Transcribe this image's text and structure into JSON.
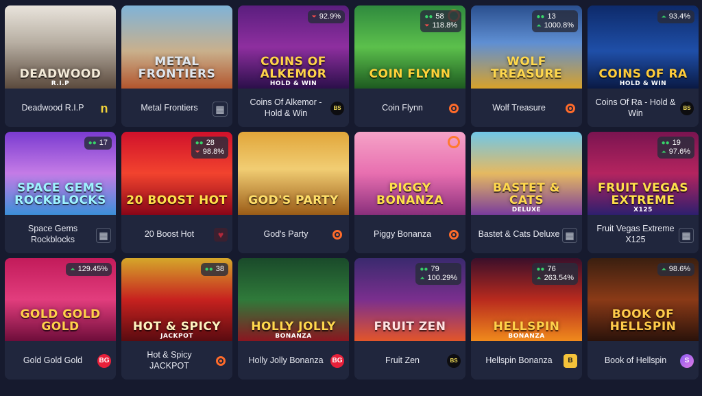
{
  "colors": {
    "page_bg": "#161a2e",
    "card_info_bg": "#20263d",
    "stat_green": "#38d36a",
    "stat_red": "#ff4d4d",
    "provider_orange": "#ff6b2a"
  },
  "games": [
    {
      "name": "Deadwood R.I.P",
      "art_title": "DEADWOOD",
      "art_sub": "R.I.P",
      "art_bg": "linear-gradient(180deg,#e9e4dc 0%,#b7aea2 45%,#5b4a3d 100%)",
      "art_color": "#f3ead8",
      "provider_icon": "nolimit-city-icon",
      "provider_glyph": "n",
      "provider_color": "#f2d33a"
    },
    {
      "name": "Metal Frontiers",
      "art_title": "METAL FRONTIERS",
      "art_sub": "",
      "art_bg": "linear-gradient(180deg,#7fb3d8 0%,#c9b08c 55%,#b2552d 100%)",
      "art_color": "#dfe6ee",
      "provider_icon": "provider-grid-icon",
      "provider_glyph": "▦",
      "provider_color": "#9aa0ad"
    },
    {
      "name": "Coins Of Alkemor - Hold & Win",
      "art_title": "COINS OF ALKEMOR",
      "art_sub": "HOLD & WIN",
      "art_bg": "linear-gradient(180deg,#5a1e7e 0%,#8e2f9f 50%,#2b0f4a 100%)",
      "art_color": "#ffd34a",
      "provider_icon": "bgaming-icon",
      "provider_glyph": "BS",
      "provider_color": "#f5e05a",
      "stats": {
        "rtp": "92.9%",
        "rtp_dir": "down"
      }
    },
    {
      "name": "Coin Flynn",
      "art_title": "COIN FLYNN",
      "art_sub": "",
      "art_bg": "linear-gradient(180deg,#2f8a3e 0%,#5cc04c 50%,#1d5a20 100%)",
      "art_color": "#ffd23a",
      "provider_icon": "ring-provider-icon",
      "provider_glyph": "",
      "provider_color": "#ff6b2a",
      "stats": {
        "players": "58",
        "rtp": "118.8%",
        "rtp_dir": "down"
      },
      "corner_ring": true
    },
    {
      "name": "Wolf Treasure",
      "art_title": "WOLF TREASURE",
      "art_sub": "",
      "art_bg": "linear-gradient(180deg,#2a4f8e 0%,#5f8fd3 45%,#d8a22a 100%)",
      "art_color": "#ffd84d",
      "provider_icon": "ring-provider-icon",
      "provider_glyph": "",
      "provider_color": "#ff6b2a",
      "stats": {
        "players": "13",
        "rtp": "1000.8%",
        "rtp_dir": "up"
      }
    },
    {
      "name": "Coins Of Ra - Hold & Win",
      "art_title": "COINS OF RA",
      "art_sub": "HOLD & WIN",
      "art_bg": "linear-gradient(180deg,#0d2a6a 0%,#1f4fa8 55%,#0a1a44 100%)",
      "art_color": "#ffcc3a",
      "provider_icon": "bgaming-icon",
      "provider_glyph": "BS",
      "provider_color": "#f5e05a",
      "stats": {
        "rtp": "93.4%",
        "rtp_dir": "up"
      }
    },
    {
      "name": "Space Gems Rockblocks",
      "art_title": "SPACE GEMS ROCKBLOCKS",
      "art_sub": "",
      "art_bg": "linear-gradient(180deg,#7a3bd0 0%,#c47be6 50%,#3c8fd8 100%)",
      "art_color": "#9ef3ff",
      "provider_icon": "provider-grid-icon",
      "provider_glyph": "▦",
      "provider_color": "#9aa0ad",
      "stats": {
        "players": "17"
      }
    },
    {
      "name": "20 Boost Hot",
      "art_title": "20 BOOST HOT",
      "art_sub": "",
      "art_bg": "linear-gradient(180deg,#d0112b 0%,#f2432e 50%,#8a0618 100%)",
      "art_color": "#ffe14a",
      "provider_icon": "heart-provider-icon",
      "provider_glyph": "♥",
      "provider_color": "#b0283a",
      "stats": {
        "players": "28",
        "rtp": "98.8%",
        "rtp_dir": "down"
      }
    },
    {
      "name": "God's Party",
      "art_title": "GOD'S PARTY",
      "art_sub": "",
      "art_bg": "linear-gradient(180deg,#e1a63a 0%,#f1cd73 45%,#9b5c17 100%)",
      "art_color": "#ffdf6a",
      "provider_icon": "ring-provider-icon",
      "provider_glyph": "",
      "provider_color": "#ff6b2a"
    },
    {
      "name": "Piggy Bonanza",
      "art_title": "PIGGY BONANZA",
      "art_sub": "",
      "art_bg": "linear-gradient(180deg,#f5a3c7 0%,#e86fb0 50%,#8a2f7c 100%)",
      "art_color": "#ffe14a",
      "provider_icon": "ring-provider-icon",
      "provider_glyph": "",
      "provider_color": "#ff6b2a",
      "corner_ring": true
    },
    {
      "name": "Bastet & Cats Deluxe",
      "art_title": "BASTET & CATS",
      "art_sub": "DELUXE",
      "art_bg": "linear-gradient(180deg,#6fc7e8 0%,#e5b961 50%,#7a3c9c 100%)",
      "art_color": "#ffd84d",
      "provider_icon": "provider-grid-icon",
      "provider_glyph": "▦",
      "provider_color": "#9aa0ad"
    },
    {
      "name": "Fruit Vegas Extreme X125",
      "art_title": "FRUIT VEGAS EXTREME",
      "art_sub": "X125",
      "art_bg": "linear-gradient(180deg,#7a1450 0%,#b4245f 50%,#2e1f6e 100%)",
      "art_color": "#ffe14a",
      "provider_icon": "provider-grid-icon",
      "provider_glyph": "▦",
      "provider_color": "#9aa0ad",
      "stats": {
        "players": "19",
        "rtp": "97.6%",
        "rtp_dir": "up"
      }
    },
    {
      "name": "Gold Gold Gold",
      "art_title": "GOLD GOLD GOLD",
      "art_sub": "",
      "art_bg": "linear-gradient(180deg,#c21b5a 0%,#e23d7d 50%,#6e0d3a 100%)",
      "art_color": "#ffd04a",
      "provider_icon": "bg-provider-icon",
      "provider_glyph": "BG",
      "provider_color": "#e8203a",
      "stats": {
        "rtp": "129.45%",
        "rtp_dir": "up"
      }
    },
    {
      "name": "Hot & Spicy JACKPOT",
      "art_title": "HOT & SPICY",
      "art_sub": "JACKPOT",
      "art_bg": "linear-gradient(180deg,#d5a72a 0%,#c7221f 50%,#5a0b10 100%)",
      "art_color": "#fff3c0",
      "provider_icon": "ring-provider-icon",
      "provider_glyph": "",
      "provider_color": "#ff6b2a",
      "stats": {
        "players": "38"
      }
    },
    {
      "name": "Holly Jolly Bonanza",
      "art_title": "HOLLY JOLLY",
      "art_sub": "BONANZA",
      "art_bg": "linear-gradient(180deg,#1a4a2a 0%,#2f7a3a 50%,#8a1620 100%)",
      "art_color": "#ffd84d",
      "provider_icon": "bg-provider-icon",
      "provider_glyph": "BG",
      "provider_color": "#e8203a"
    },
    {
      "name": "Fruit Zen",
      "art_title": "FRUIT ZEN",
      "art_sub": "",
      "art_bg": "linear-gradient(180deg,#3a2a6e 0%,#7a2f8e 50%,#e2552a 100%)",
      "art_color": "#ffe3e3",
      "provider_icon": "bgaming-icon",
      "provider_glyph": "BS",
      "provider_color": "#f5e05a",
      "stats": {
        "players": "79",
        "rtp": "100.29%",
        "rtp_dir": "up"
      }
    },
    {
      "name": "Hellspin Bonanza",
      "art_title": "HELLSPIN",
      "art_sub": "BONANZA",
      "art_bg": "linear-gradient(180deg,#3b0f2a 0%,#b82a1e 50%,#f08a1c 100%)",
      "art_color": "#ffd24a",
      "provider_icon": "b-provider-icon",
      "provider_glyph": "B",
      "provider_color": "#f5c33a",
      "stats": {
        "players": "76",
        "rtp": "263.54%",
        "rtp_dir": "up"
      }
    },
    {
      "name": "Book of Hellspin",
      "art_title": "BOOK OF HELLSPIN",
      "art_sub": "",
      "art_bg": "linear-gradient(180deg,#3a1f10 0%,#8a3a17 50%,#2a120a 100%)",
      "art_color": "#ffcb4a",
      "provider_icon": "s-provider-icon",
      "provider_glyph": "S",
      "provider_color": "#c98bf0",
      "stats": {
        "rtp": "98.6%",
        "rtp_dir": "up"
      }
    }
  ]
}
